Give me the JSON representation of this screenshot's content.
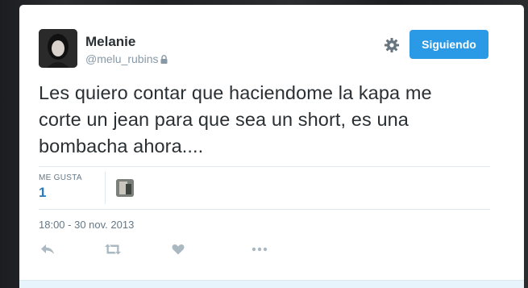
{
  "user": {
    "name": "Melanie",
    "handle": "@melu_rubins",
    "protected_icon": "lock-icon",
    "avatar_icon": "profile-photo"
  },
  "header": {
    "settings_icon": "gear-icon",
    "follow_label": "Siguiendo",
    "follow_color": "#2b9ae6"
  },
  "tweet": {
    "text_lines": [
      "Les quiero contar que haciendome la kapa me",
      "corte un jean para que sea un short, es una",
      "bombacha ahora...."
    ]
  },
  "stats": {
    "likes_label": "ME GUSTA",
    "likes_count": "1",
    "liker_avatar_icon": "liker-avatar"
  },
  "timestamp": "18:00 - 30 nov. 2013",
  "actions": [
    {
      "name": "reply",
      "icon": "reply-icon"
    },
    {
      "name": "retweet",
      "icon": "retweet-icon"
    },
    {
      "name": "like",
      "icon": "heart-icon"
    },
    {
      "name": "more",
      "icon": "more-icon"
    }
  ],
  "colors": {
    "text": "#292f33",
    "muted": "#8899a6",
    "link": "#2b7bb9",
    "icon": "#aab8c2"
  }
}
